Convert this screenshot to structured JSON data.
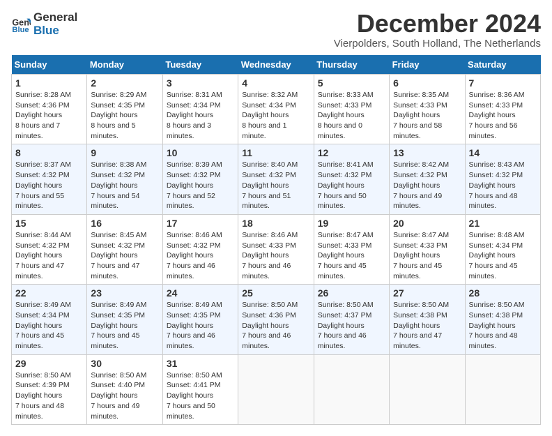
{
  "logo": {
    "line1": "General",
    "line2": "Blue"
  },
  "title": "December 2024",
  "subtitle": "Vierpolders, South Holland, The Netherlands",
  "weekdays": [
    "Sunday",
    "Monday",
    "Tuesday",
    "Wednesday",
    "Thursday",
    "Friday",
    "Saturday"
  ],
  "weeks": [
    [
      {
        "day": "1",
        "sunrise": "8:28 AM",
        "sunset": "4:36 PM",
        "daylight": "8 hours and 7 minutes."
      },
      {
        "day": "2",
        "sunrise": "8:29 AM",
        "sunset": "4:35 PM",
        "daylight": "8 hours and 5 minutes."
      },
      {
        "day": "3",
        "sunrise": "8:31 AM",
        "sunset": "4:34 PM",
        "daylight": "8 hours and 3 minutes."
      },
      {
        "day": "4",
        "sunrise": "8:32 AM",
        "sunset": "4:34 PM",
        "daylight": "8 hours and 1 minute."
      },
      {
        "day": "5",
        "sunrise": "8:33 AM",
        "sunset": "4:33 PM",
        "daylight": "8 hours and 0 minutes."
      },
      {
        "day": "6",
        "sunrise": "8:35 AM",
        "sunset": "4:33 PM",
        "daylight": "7 hours and 58 minutes."
      },
      {
        "day": "7",
        "sunrise": "8:36 AM",
        "sunset": "4:33 PM",
        "daylight": "7 hours and 56 minutes."
      }
    ],
    [
      {
        "day": "8",
        "sunrise": "8:37 AM",
        "sunset": "4:32 PM",
        "daylight": "7 hours and 55 minutes."
      },
      {
        "day": "9",
        "sunrise": "8:38 AM",
        "sunset": "4:32 PM",
        "daylight": "7 hours and 54 minutes."
      },
      {
        "day": "10",
        "sunrise": "8:39 AM",
        "sunset": "4:32 PM",
        "daylight": "7 hours and 52 minutes."
      },
      {
        "day": "11",
        "sunrise": "8:40 AM",
        "sunset": "4:32 PM",
        "daylight": "7 hours and 51 minutes."
      },
      {
        "day": "12",
        "sunrise": "8:41 AM",
        "sunset": "4:32 PM",
        "daylight": "7 hours and 50 minutes."
      },
      {
        "day": "13",
        "sunrise": "8:42 AM",
        "sunset": "4:32 PM",
        "daylight": "7 hours and 49 minutes."
      },
      {
        "day": "14",
        "sunrise": "8:43 AM",
        "sunset": "4:32 PM",
        "daylight": "7 hours and 48 minutes."
      }
    ],
    [
      {
        "day": "15",
        "sunrise": "8:44 AM",
        "sunset": "4:32 PM",
        "daylight": "7 hours and 47 minutes."
      },
      {
        "day": "16",
        "sunrise": "8:45 AM",
        "sunset": "4:32 PM",
        "daylight": "7 hours and 47 minutes."
      },
      {
        "day": "17",
        "sunrise": "8:46 AM",
        "sunset": "4:32 PM",
        "daylight": "7 hours and 46 minutes."
      },
      {
        "day": "18",
        "sunrise": "8:46 AM",
        "sunset": "4:33 PM",
        "daylight": "7 hours and 46 minutes."
      },
      {
        "day": "19",
        "sunrise": "8:47 AM",
        "sunset": "4:33 PM",
        "daylight": "7 hours and 45 minutes."
      },
      {
        "day": "20",
        "sunrise": "8:47 AM",
        "sunset": "4:33 PM",
        "daylight": "7 hours and 45 minutes."
      },
      {
        "day": "21",
        "sunrise": "8:48 AM",
        "sunset": "4:34 PM",
        "daylight": "7 hours and 45 minutes."
      }
    ],
    [
      {
        "day": "22",
        "sunrise": "8:49 AM",
        "sunset": "4:34 PM",
        "daylight": "7 hours and 45 minutes."
      },
      {
        "day": "23",
        "sunrise": "8:49 AM",
        "sunset": "4:35 PM",
        "daylight": "7 hours and 45 minutes."
      },
      {
        "day": "24",
        "sunrise": "8:49 AM",
        "sunset": "4:35 PM",
        "daylight": "7 hours and 46 minutes."
      },
      {
        "day": "25",
        "sunrise": "8:50 AM",
        "sunset": "4:36 PM",
        "daylight": "7 hours and 46 minutes."
      },
      {
        "day": "26",
        "sunrise": "8:50 AM",
        "sunset": "4:37 PM",
        "daylight": "7 hours and 46 minutes."
      },
      {
        "day": "27",
        "sunrise": "8:50 AM",
        "sunset": "4:38 PM",
        "daylight": "7 hours and 47 minutes."
      },
      {
        "day": "28",
        "sunrise": "8:50 AM",
        "sunset": "4:38 PM",
        "daylight": "7 hours and 48 minutes."
      }
    ],
    [
      {
        "day": "29",
        "sunrise": "8:50 AM",
        "sunset": "4:39 PM",
        "daylight": "7 hours and 48 minutes."
      },
      {
        "day": "30",
        "sunrise": "8:50 AM",
        "sunset": "4:40 PM",
        "daylight": "7 hours and 49 minutes."
      },
      {
        "day": "31",
        "sunrise": "8:50 AM",
        "sunset": "4:41 PM",
        "daylight": "7 hours and 50 minutes."
      },
      null,
      null,
      null,
      null
    ]
  ],
  "labels": {
    "sunrise": "Sunrise:",
    "sunset": "Sunset:",
    "daylight": "Daylight hours"
  }
}
